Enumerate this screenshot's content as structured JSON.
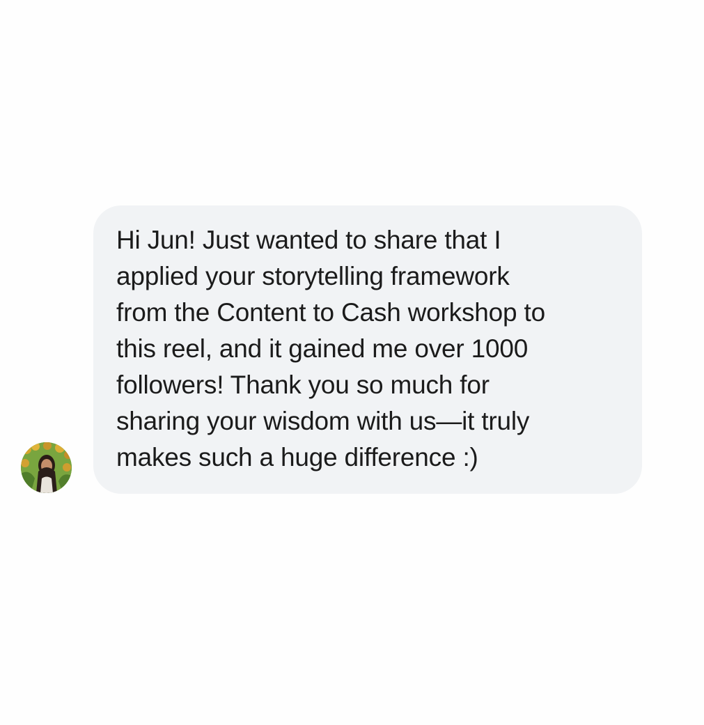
{
  "conversation": {
    "sender": {
      "avatar_icon": "profile-photo-icon"
    },
    "message": {
      "text": "Hi Jun! Just wanted to share that I\napplied your storytelling framework\nfrom the Content to Cash workshop to\nthis reel, and it gained me over 1000\nfollowers! Thank you so much for\nsharing your wisdom with us—it truly\nmakes such a huge difference :)"
    },
    "colors": {
      "background": "#fefefe",
      "bubble": "#f1f3f5",
      "text": "#1b1b1b"
    }
  }
}
